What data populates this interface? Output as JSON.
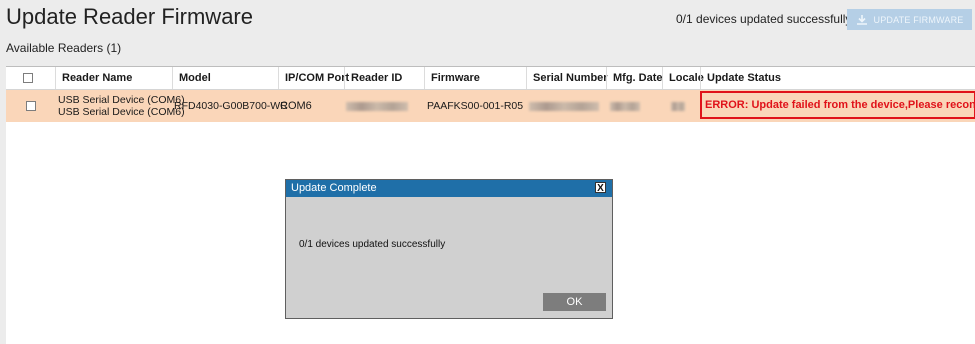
{
  "header": {
    "title": "Update Reader Firmware",
    "available_readers": "Available Readers (1)",
    "status_text": "0/1 devices updated successfully",
    "update_button_label": "UPDATE FIRMWARE"
  },
  "table": {
    "columns": [
      "Reader Name",
      "Model",
      "IP/COM Port",
      "Reader ID",
      "Firmware",
      "Serial Number",
      "Mfg. Date",
      "Locale",
      "Update Status"
    ],
    "rows": [
      {
        "reader_name_line1": "USB Serial Device (COM6)",
        "reader_name_line2": "USB Serial Device (COM6)",
        "model": "RFD4030-G00B700-WR",
        "port": "COM6",
        "firmware": "PAAFKS00-001-R05",
        "update_status": "ERROR: Update failed from the device,Please reconnect reader"
      }
    ]
  },
  "dialog": {
    "title": "Update Complete",
    "close_label": "X",
    "message": "0/1 devices updated successfully",
    "ok_label": "OK"
  },
  "colors": {
    "row_highlight": "#fad6b9",
    "error": "#e0121a",
    "dialog_title_bar": "#1f6fa8",
    "update_button": "#b5cfe6"
  }
}
